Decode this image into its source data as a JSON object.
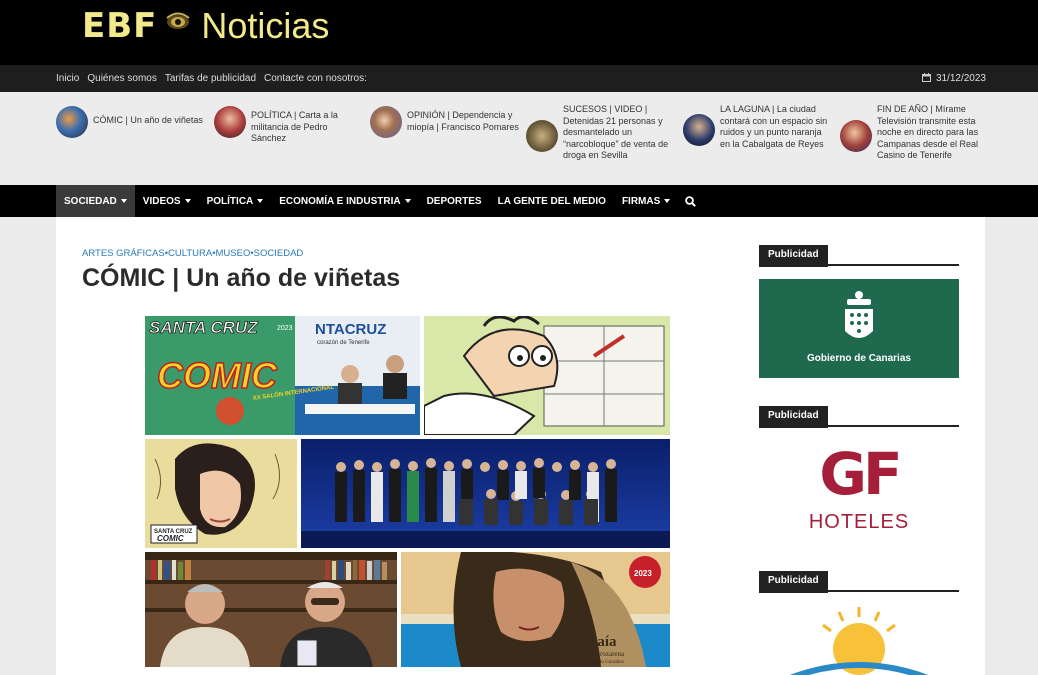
{
  "logo": {
    "prefix": "EBF",
    "name": "Noticias"
  },
  "top_nav": {
    "links": [
      "Inicio",
      "Quiénes somos",
      "Tarifas de publicidad",
      "Contacte con nosotros:"
    ],
    "date": "31/12/2023"
  },
  "ticker": [
    {
      "text": "CÓMIC | Un año de viñetas"
    },
    {
      "text": "POLÍTICA | Carta a la militancia de Pedro Sánchez"
    },
    {
      "text": "OPINIÓN | Dependencia y miopía | Francisco Pomares"
    },
    {
      "text": "SUCESOS | VIDEO | Detenidas 21 personas y desmantelado un “narcobloque” de venta de droga en Sevilla"
    },
    {
      "text": "LA LAGUNA | La ciudad contará con un espacio sin ruidos y un punto naranja en la Cabalgata de Reyes"
    },
    {
      "text": "FIN DE AÑO | Mírame Televisión transmite esta noche en directo para las Campanas desde el Real Casino de Tenerife"
    }
  ],
  "main_nav": {
    "items": [
      {
        "label": "SOCIEDAD",
        "caret": true
      },
      {
        "label": "VIDEOS",
        "caret": true
      },
      {
        "label": "POLÍTICA",
        "caret": true
      },
      {
        "label": "ECONOMÍA E INDUSTRIA",
        "caret": true
      },
      {
        "label": "DEPORTES",
        "caret": false
      },
      {
        "label": "LA GENTE DEL MEDIO",
        "caret": false
      },
      {
        "label": "FIRMAS",
        "caret": true
      }
    ]
  },
  "article": {
    "categories": "ARTES GRÁFICAS•CULTURA•MUSEO•SOCIEDAD",
    "title": "CÓMIC | Un año de viñetas",
    "collage": {
      "banner_top": "SANTA CRUZ",
      "banner_year": "2023",
      "banner_comic": "COMIC",
      "banner_right": "NTACRUZ",
      "banner_right_sub": "corazón de Tenerife",
      "salon_text": "XX SALÓN INTERNACIONAL",
      "logo_small": "SANTA CRUZ",
      "logo_small_comic": "COMIC",
      "poster_title": "Maraía",
      "poster_sub": "de Rafael Arozarena",
      "poster_author": "por Eduardo González",
      "badge_year": "2023"
    }
  },
  "sidebar": {
    "ad_label": "Publicidad",
    "ads": [
      {
        "text": "Gobierno de Canarias"
      },
      {
        "text": "HOTELES",
        "mark": "GF"
      }
    ]
  },
  "colors": {
    "logo_yellow": "#f2ea8a",
    "category_blue": "#2a7ab8",
    "canarias_green": "#1f6a4e",
    "gf_red": "#a51e3a"
  }
}
